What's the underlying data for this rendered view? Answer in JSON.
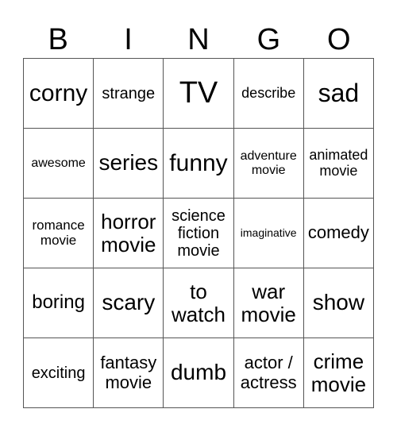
{
  "header": [
    "B",
    "I",
    "N",
    "G",
    "O"
  ],
  "cells": [
    [
      "corny",
      "strange",
      "TV",
      "describe",
      "sad"
    ],
    [
      "awesome",
      "series",
      "funny",
      "adventure movie",
      "animated movie"
    ],
    [
      "romance movie",
      "horror movie",
      "science fiction movie",
      "imaginative",
      "comedy"
    ],
    [
      "boring",
      "scary",
      "to watch",
      "war movie",
      "show"
    ],
    [
      "exciting",
      "fantasy movie",
      "dumb",
      "actor / actress",
      "crime movie"
    ]
  ]
}
